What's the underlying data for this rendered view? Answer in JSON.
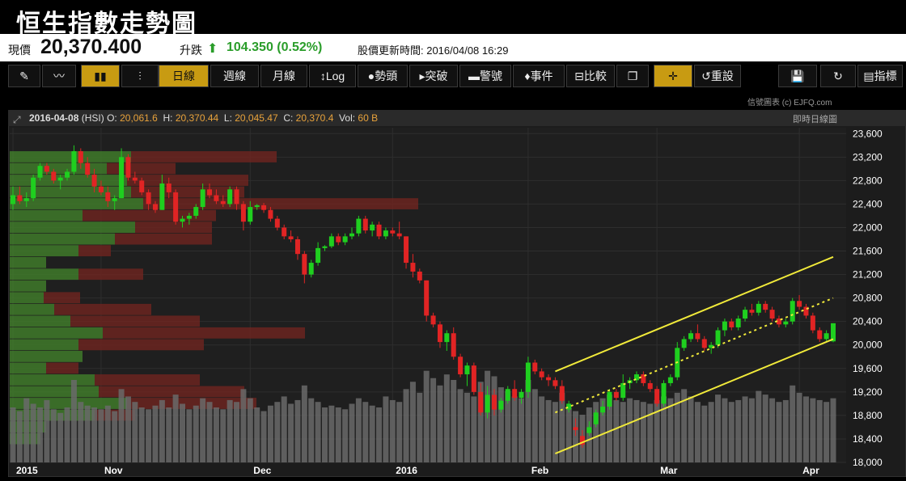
{
  "title": "恒生指數走勢圖",
  "quote": {
    "price_label": "現價",
    "price": "20,370.400",
    "change_label": "升跌",
    "change": "104.350 (0.52%)",
    "update_label": "股價更新時間: 2016/04/08 16:29",
    "up_color": "#2a9d2a"
  },
  "toolbar": {
    "items": [
      {
        "name": "draw-tool-button",
        "label": "✎",
        "icon": "pencil-icon",
        "active": false
      },
      {
        "name": "line-chart-button",
        "label": "〰",
        "icon": "line-chart-icon",
        "active": false
      },
      {
        "name": "candle-chart-button",
        "label": "▮▮",
        "icon": "candlestick-icon",
        "active": true
      },
      {
        "name": "ohlc-chart-button",
        "label": "⫶",
        "icon": "ohlc-icon",
        "active": false
      },
      {
        "name": "daily-button",
        "label": "日線",
        "active": true
      },
      {
        "name": "weekly-button",
        "label": "週線",
        "active": false
      },
      {
        "name": "monthly-button",
        "label": "月線",
        "active": false
      },
      {
        "name": "log-button",
        "label": "↕Log",
        "active": false
      },
      {
        "name": "trend-button",
        "label": "●勢頭",
        "active": false
      },
      {
        "name": "breakout-button",
        "label": "▸突破",
        "active": false
      },
      {
        "name": "alert-button",
        "label": "▬警號",
        "active": false
      },
      {
        "name": "event-button",
        "label": "♦事件",
        "active": false
      },
      {
        "name": "compare-button",
        "label": "⊟比較",
        "active": false
      },
      {
        "name": "copy-button",
        "label": "❐",
        "icon": "copy-icon",
        "active": false
      },
      {
        "name": "crosshair-button",
        "label": "✛",
        "icon": "crosshair-icon",
        "active": true
      },
      {
        "name": "reset-button",
        "label": "↺重設",
        "active": false
      },
      {
        "name": "save-button",
        "label": "💾",
        "icon": "save-icon",
        "active": false
      },
      {
        "name": "redo-button",
        "label": "↻",
        "icon": "redo-icon",
        "active": false
      },
      {
        "name": "indicator-button",
        "label": "▤指標",
        "active": false
      }
    ]
  },
  "credit": "信號圖表 (c) EJFQ.com",
  "info": {
    "date": "2016-04-08",
    "symbol": "(HSI)",
    "o_label": "O:",
    "o": "20,061.6",
    "h_label": "H:",
    "h": "20,370.44",
    "l_label": "L:",
    "l": "20,045.47",
    "c_label": "C:",
    "c": "20,370.4",
    "vol_label": "Vol:",
    "vol": "60 B",
    "right": "即時日線圖"
  },
  "chart_data": {
    "type": "candlestick",
    "y_ticks": [
      23600,
      23200,
      22800,
      22400,
      22000,
      21600,
      21200,
      20800,
      20400,
      20000,
      19600,
      19200,
      18800,
      18400,
      18000
    ],
    "y_tick_labels": [
      "23,600",
      "23,200",
      "22,800",
      "22,400",
      "22,000",
      "21,600",
      "21,200",
      "20,800",
      "20,400",
      "20,000",
      "19,600",
      "19,200",
      "18,800",
      "18,400",
      "18,000"
    ],
    "ylim": [
      18000,
      23700
    ],
    "x_labels": [
      {
        "label": "2015",
        "i": 0
      },
      {
        "label": "Nov",
        "i": 13
      },
      {
        "label": "Dec",
        "i": 35
      },
      {
        "label": "2016",
        "i": 56
      },
      {
        "label": "Feb",
        "i": 76
      },
      {
        "label": "Mar",
        "i": 95
      },
      {
        "label": "Apr",
        "i": 116
      }
    ],
    "candles": [
      [
        22400,
        22700,
        22300,
        22550
      ],
      [
        22550,
        22700,
        22400,
        22450
      ],
      [
        22450,
        22600,
        22350,
        22500
      ],
      [
        22500,
        22900,
        22450,
        22850
      ],
      [
        22850,
        23100,
        22800,
        23050
      ],
      [
        23050,
        23100,
        22900,
        22950
      ],
      [
        22950,
        23000,
        22750,
        22800
      ],
      [
        22800,
        22900,
        22650,
        22850
      ],
      [
        22850,
        23000,
        22800,
        22950
      ],
      [
        22950,
        23400,
        22900,
        23300
      ],
      [
        23300,
        23350,
        23000,
        23100
      ],
      [
        23100,
        23200,
        22850,
        22900
      ],
      [
        22900,
        23000,
        22600,
        22700
      ],
      [
        22700,
        22800,
        22550,
        22600
      ],
      [
        22600,
        22700,
        22350,
        22450
      ],
      [
        22450,
        22550,
        22300,
        22500
      ],
      [
        22500,
        23350,
        22500,
        23200
      ],
      [
        23200,
        23250,
        22800,
        22850
      ],
      [
        22850,
        22950,
        22750,
        22800
      ],
      [
        22800,
        22850,
        22550,
        22600
      ],
      [
        22600,
        22650,
        22300,
        22400
      ],
      [
        22400,
        22450,
        22250,
        22300
      ],
      [
        22300,
        22900,
        22300,
        22750
      ],
      [
        22750,
        22850,
        22500,
        22600
      ],
      [
        22600,
        22650,
        22050,
        22100
      ],
      [
        22100,
        22200,
        22000,
        22150
      ],
      [
        22150,
        22250,
        22050,
        22200
      ],
      [
        22200,
        22400,
        22150,
        22350
      ],
      [
        22350,
        22750,
        22300,
        22650
      ],
      [
        22650,
        22750,
        22500,
        22550
      ],
      [
        22550,
        22650,
        22400,
        22450
      ],
      [
        22450,
        22550,
        22350,
        22400
      ],
      [
        22400,
        22700,
        22350,
        22650
      ],
      [
        22650,
        22700,
        22300,
        22400
      ],
      [
        22400,
        22450,
        21950,
        22100
      ],
      [
        22100,
        22450,
        22050,
        22350
      ],
      [
        22350,
        22400,
        22300,
        22380
      ],
      [
        22380,
        22420,
        22250,
        22300
      ],
      [
        22300,
        22350,
        22100,
        22150
      ],
      [
        22150,
        22200,
        21950,
        22000
      ],
      [
        22000,
        22050,
        21800,
        21850
      ],
      [
        21850,
        21950,
        21750,
        21800
      ],
      [
        21800,
        21850,
        21450,
        21550
      ],
      [
        21550,
        21600,
        21050,
        21200
      ],
      [
        21200,
        21450,
        21150,
        21400
      ],
      [
        21400,
        21750,
        21350,
        21650
      ],
      [
        21650,
        21700,
        21600,
        21680
      ],
      [
        21680,
        21900,
        21650,
        21850
      ],
      [
        21850,
        21900,
        21700,
        21750
      ],
      [
        21750,
        21900,
        21700,
        21850
      ],
      [
        21850,
        22000,
        21800,
        21900
      ],
      [
        21900,
        22200,
        21850,
        22150
      ],
      [
        22150,
        22200,
        21900,
        21950
      ],
      [
        21950,
        22100,
        21850,
        22050
      ],
      [
        22050,
        22100,
        21800,
        21850
      ],
      [
        21850,
        22000,
        21800,
        21950
      ],
      [
        21950,
        22000,
        21850,
        21900
      ],
      [
        21900,
        22100,
        21800,
        21850
      ],
      [
        21850,
        21850,
        21300,
        21400
      ],
      [
        21400,
        21550,
        21150,
        21250
      ],
      [
        21250,
        21300,
        21050,
        21100
      ],
      [
        21100,
        21100,
        20400,
        20500
      ],
      [
        20500,
        20550,
        20300,
        20350
      ],
      [
        20350,
        20400,
        19950,
        20050
      ],
      [
        20050,
        20250,
        19900,
        20200
      ],
      [
        20200,
        20300,
        19750,
        19800
      ],
      [
        19800,
        19850,
        19450,
        19500
      ],
      [
        19500,
        19700,
        19300,
        19650
      ],
      [
        19650,
        19700,
        19150,
        19200
      ],
      [
        19200,
        19350,
        18800,
        18850
      ],
      [
        18850,
        19300,
        18750,
        19150
      ],
      [
        19150,
        19250,
        18800,
        18900
      ],
      [
        18900,
        19100,
        18850,
        19050
      ],
      [
        19050,
        19300,
        19000,
        19250
      ],
      [
        19250,
        19400,
        19050,
        19100
      ],
      [
        19100,
        19250,
        19000,
        19200
      ],
      [
        19200,
        19800,
        19100,
        19700
      ],
      [
        19700,
        19750,
        19500,
        19550
      ],
      [
        19550,
        19600,
        19400,
        19450
      ],
      [
        19450,
        19500,
        19300,
        19400
      ],
      [
        19400,
        19450,
        19250,
        19300
      ],
      [
        19300,
        19400,
        19000,
        19050
      ],
      [
        18900,
        19050,
        18850,
        19000
      ],
      [
        18600,
        18750,
        18450,
        18550
      ],
      [
        18450,
        18550,
        18250,
        18300
      ],
      [
        18500,
        18700,
        18450,
        18600
      ],
      [
        18650,
        18900,
        18600,
        18850
      ],
      [
        18850,
        19050,
        18800,
        18950
      ],
      [
        18950,
        19250,
        18900,
        19200
      ],
      [
        19200,
        19250,
        19050,
        19100
      ],
      [
        19100,
        19500,
        19050,
        19350
      ],
      [
        19350,
        19450,
        19250,
        19400
      ],
      [
        19400,
        19550,
        19350,
        19500
      ],
      [
        19500,
        19550,
        19300,
        19350
      ],
      [
        19350,
        19400,
        19200,
        19250
      ],
      [
        19250,
        19300,
        18950,
        19000
      ],
      [
        19000,
        19400,
        18950,
        19350
      ],
      [
        19350,
        19500,
        19300,
        19450
      ],
      [
        19450,
        20050,
        19400,
        19950
      ],
      [
        19950,
        20150,
        19900,
        20100
      ],
      [
        20100,
        20250,
        20050,
        20200
      ],
      [
        20200,
        20350,
        20050,
        20100
      ],
      [
        20100,
        20150,
        19900,
        19950
      ],
      [
        19950,
        20050,
        19850,
        20000
      ],
      [
        20000,
        20300,
        19950,
        20250
      ],
      [
        20250,
        20450,
        20150,
        20400
      ],
      [
        20400,
        20450,
        20250,
        20300
      ],
      [
        20300,
        20500,
        20250,
        20450
      ],
      [
        20450,
        20650,
        20400,
        20600
      ],
      [
        20600,
        20700,
        20500,
        20550
      ],
      [
        20550,
        20750,
        20500,
        20700
      ],
      [
        20700,
        20750,
        20550,
        20600
      ],
      [
        20600,
        20650,
        20400,
        20450
      ],
      [
        20450,
        20500,
        20300,
        20350
      ],
      [
        20350,
        20450,
        20300,
        20400
      ],
      [
        20400,
        20800,
        20350,
        20750
      ],
      [
        20750,
        20850,
        20600,
        20650
      ],
      [
        20650,
        20700,
        20450,
        20500
      ],
      [
        20500,
        20550,
        20200,
        20250
      ],
      [
        20250,
        20300,
        20050,
        20100
      ],
      [
        20100,
        20250,
        20050,
        20200
      ],
      [
        20061.6,
        20370.44,
        20045.47,
        20370.4
      ]
    ],
    "volume": [
      30,
      28,
      35,
      32,
      30,
      34,
      29,
      27,
      30,
      45,
      33,
      31,
      30,
      29,
      31,
      28,
      40,
      36,
      33,
      30,
      29,
      31,
      34,
      30,
      37,
      32,
      29,
      31,
      35,
      33,
      30,
      29,
      34,
      33,
      40,
      35,
      30,
      28,
      31,
      33,
      36,
      32,
      34,
      42,
      35,
      33,
      30,
      31,
      30,
      29,
      32,
      35,
      33,
      31,
      30,
      36,
      34,
      33,
      40,
      44,
      38,
      50,
      46,
      42,
      48,
      45,
      40,
      38,
      36,
      44,
      50,
      47,
      41,
      39,
      36,
      35,
      45,
      40,
      36,
      34,
      33,
      38,
      30,
      28,
      26,
      30,
      33,
      35,
      37,
      34,
      33,
      35,
      34,
      33,
      32,
      34,
      36,
      35,
      38,
      40,
      36,
      33,
      31,
      33,
      37,
      35,
      33,
      34,
      36,
      35,
      39,
      37,
      35,
      33,
      34,
      42,
      38,
      36,
      35,
      34,
      33,
      35
    ],
    "volume_max": 60,
    "volume_profile": [
      {
        "price": 23200,
        "green": 150,
        "red": 180
      },
      {
        "price": 23000,
        "green": 120,
        "red": 85
      },
      {
        "price": 22800,
        "green": 145,
        "red": 150
      },
      {
        "price": 22600,
        "green": 150,
        "red": 140
      },
      {
        "price": 22400,
        "green": 165,
        "red": 340
      },
      {
        "price": 22200,
        "green": 90,
        "red": 165
      },
      {
        "price": 22000,
        "green": 155,
        "red": 95
      },
      {
        "price": 21800,
        "green": 130,
        "red": 120
      },
      {
        "price": 21600,
        "green": 85,
        "red": 40
      },
      {
        "price": 21400,
        "green": 45,
        "red": 0
      },
      {
        "price": 21200,
        "green": 85,
        "red": 80
      },
      {
        "price": 21000,
        "green": 45,
        "red": 0
      },
      {
        "price": 20800,
        "green": 42,
        "red": 45
      },
      {
        "price": 20600,
        "green": 55,
        "red": 120
      },
      {
        "price": 20400,
        "green": 75,
        "red": 160
      },
      {
        "price": 20200,
        "green": 115,
        "red": 250
      },
      {
        "price": 20000,
        "green": 85,
        "red": 155
      },
      {
        "price": 19800,
        "green": 90,
        "red": 0
      },
      {
        "price": 19600,
        "green": 45,
        "red": 40
      },
      {
        "price": 19400,
        "green": 105,
        "red": 130
      },
      {
        "price": 19200,
        "green": 110,
        "red": 180
      },
      {
        "price": 19000,
        "green": 145,
        "red": 160
      },
      {
        "price": 18800,
        "green": 105,
        "red": 50
      },
      {
        "price": 18600,
        "green": 45,
        "red": 0
      },
      {
        "price": 18400,
        "green": 38,
        "red": 0
      }
    ],
    "channel_lines": [
      {
        "style": "solid",
        "from": [
          80,
          19550
        ],
        "to": [
          121,
          21500
        ]
      },
      {
        "style": "dotted",
        "from": [
          80,
          18850
        ],
        "to": [
          121,
          20800
        ]
      },
      {
        "style": "solid",
        "from": [
          80,
          18150
        ],
        "to": [
          121,
          20100
        ]
      }
    ],
    "colors": {
      "up": "#1fcf1f",
      "down": "#e12424",
      "line": "#f1ea3a",
      "volume": "#6a6a6a",
      "profile_green": "#3f7a2a",
      "profile_red": "#6b2420"
    }
  }
}
